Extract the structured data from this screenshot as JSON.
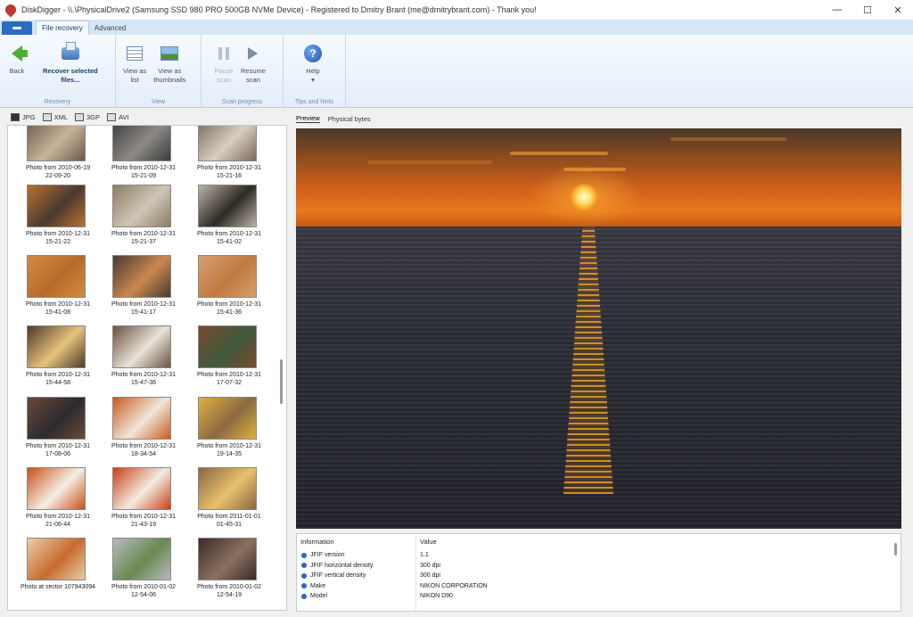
{
  "window": {
    "title": "DiskDigger - \\\\.\\PhysicalDrive2 (Samsung SSD 980 PRO 500GB NVMe Device) - Registered to Dmitry Brant (me@dmitrybrant.com) - Thank you!",
    "minimize": "—",
    "maximize": "☐",
    "close": "✕"
  },
  "ribbon_tabs": [
    "File recovery",
    "Advanced"
  ],
  "ribbon": {
    "recovery": {
      "label": "Recovery",
      "back": "Back",
      "recover_line1": "Recover selected",
      "recover_line2": "files..."
    },
    "view": {
      "label": "View",
      "list_line1": "View as",
      "list_line2": "list",
      "thumbs_line1": "View as",
      "thumbs_line2": "thumbnails"
    },
    "scan": {
      "label": "Scan progress",
      "pause_line1": "Pause",
      "pause_line2": "scan",
      "resume_line1": "Resume",
      "resume_line2": "scan"
    },
    "tips": {
      "label": "Tips and hints",
      "help": "Help",
      "help_arrow": "▾"
    }
  },
  "file_types": [
    "JPG",
    "XML",
    "3GP",
    "AVI"
  ],
  "thumbnails": [
    {
      "line1": "Photo from 2010-06-19",
      "line2": "22-09-20",
      "colors": [
        "#6b5a48",
        "#c9b49a"
      ]
    },
    {
      "line1": "Photo from 2010-12-31",
      "line2": "15-21-09",
      "colors": [
        "#3b3b3b",
        "#8d8a86"
      ]
    },
    {
      "line1": "Photo from 2010-12-31",
      "line2": "15-21-16",
      "colors": [
        "#7a6a5a",
        "#d8cfc2"
      ]
    },
    {
      "line1": "Photo from 2010-12-31",
      "line2": "15-21-22",
      "colors": [
        "#b9712f",
        "#4a3a30"
      ]
    },
    {
      "line1": "Photo from 2010-12-31",
      "line2": "15-21-37",
      "colors": [
        "#8e7c66",
        "#cfc5b6"
      ]
    },
    {
      "line1": "Photo from 2010-12-31",
      "line2": "15-41-02",
      "colors": [
        "#b8b2a8",
        "#2e2a24"
      ]
    },
    {
      "line1": "Photo from 2010-12-31",
      "line2": "15-41-08",
      "colors": [
        "#d48a40",
        "#b76b2a"
      ]
    },
    {
      "line1": "Photo from 2010-12-31",
      "line2": "15-41-17",
      "colors": [
        "#4a3a30",
        "#c98850"
      ]
    },
    {
      "line1": "Photo from 2010-12-31",
      "line2": "15-41-36",
      "colors": [
        "#d6a070",
        "#c07a40"
      ]
    },
    {
      "line1": "Photo from 2010-12-31",
      "line2": "15-44-58",
      "colors": [
        "#4d3a2a",
        "#e6c27a"
      ]
    },
    {
      "line1": "Photo from 2010-12-31",
      "line2": "15-47-36",
      "colors": [
        "#6a5240",
        "#e8e2d8"
      ]
    },
    {
      "line1": "Photo from 2010-12-31",
      "line2": "17-07-32",
      "colors": [
        "#7a4a30",
        "#3e5a3a"
      ]
    },
    {
      "line1": "Photo from 2010-12-31",
      "line2": "17-08-06",
      "colors": [
        "#6a4a38",
        "#2c2a2e"
      ]
    },
    {
      "line1": "Photo from 2010-12-31",
      "line2": "18-34-54",
      "colors": [
        "#c85a20",
        "#f0e6d8"
      ]
    },
    {
      "line1": "Photo from 2010-12-31",
      "line2": "19-14-35",
      "colors": [
        "#e0b040",
        "#8a6a40"
      ]
    },
    {
      "line1": "Photo from 2010-12-31",
      "line2": "21-06-44",
      "colors": [
        "#c8501a",
        "#f4efe4"
      ]
    },
    {
      "line1": "Photo from 2010-12-31",
      "line2": "21-43-19",
      "colors": [
        "#c84018",
        "#f2ece0"
      ]
    },
    {
      "line1": "Photo from 2011-01-01",
      "line2": "01-45-31",
      "colors": [
        "#8a6840",
        "#e8c070"
      ]
    },
    {
      "line1": "Photo at sector 107943094",
      "line2": "",
      "colors": [
        "#e8cfa8",
        "#c86a30"
      ]
    },
    {
      "line1": "Photo from 2010-01-02",
      "line2": "12-54-06",
      "colors": [
        "#b8b8c0",
        "#6a8a50"
      ]
    },
    {
      "line1": "Photo from 2010-01-02",
      "line2": "12-54-19",
      "colors": [
        "#3a2a2a",
        "#8a7060"
      ]
    }
  ],
  "preview_tabs": [
    "Preview",
    "Physical bytes"
  ],
  "info": {
    "header_name": "Information",
    "header_value": "Value",
    "rows": [
      {
        "name": "JFIF version",
        "value": "1.1"
      },
      {
        "name": "JFIF horizontal density",
        "value": "300 dpi"
      },
      {
        "name": "JFIF vertical density",
        "value": "300 dpi"
      },
      {
        "name": "Make",
        "value": "NIKON CORPORATION"
      },
      {
        "name": "Model",
        "value": "NIKON D90"
      }
    ]
  },
  "colors": {
    "ribbon_tab_bg": "#d6e6f7",
    "app_menu": "#2a6bc4",
    "accent_text": "#1d3f74"
  }
}
